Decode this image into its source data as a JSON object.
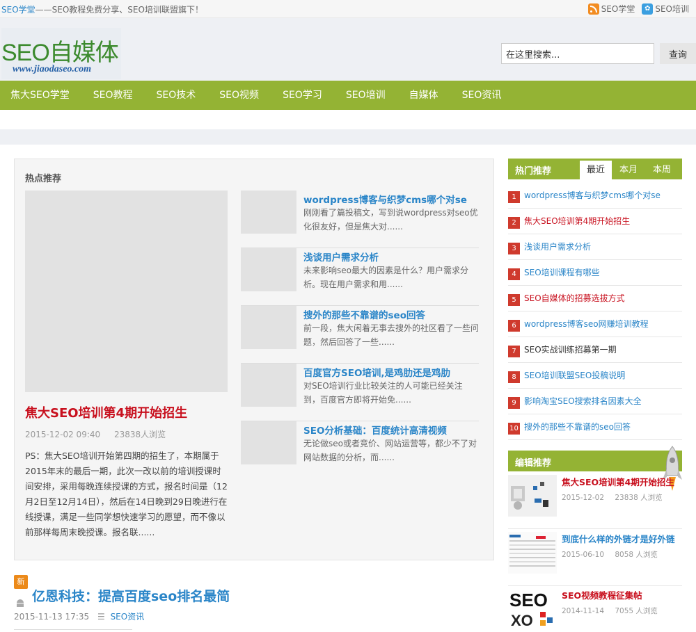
{
  "topbar": {
    "brand": "SEO学堂",
    "tagline": "——SEO教程免费分享、SEO培训联盟旗下！",
    "rss_label": "SEO学堂",
    "weibo_label": "SEO培训"
  },
  "header": {
    "logo_text": "SEO自媒体",
    "logo_url_text": "www.jiaodaseo.com",
    "search_value": "在这里搜索...",
    "search_button": "查询"
  },
  "nav": {
    "items": [
      "焦大SEO学堂",
      "SEO教程",
      "SEO技术",
      "SEO视频",
      "SEO学习",
      "SEO培训",
      "自媒体",
      "SEO资讯"
    ]
  },
  "hot": {
    "title": "热点推荐",
    "featured": {
      "title": "焦大SEO培训第4期开始招生",
      "date": "2015-12-02 09:40",
      "views": "23838人浏览",
      "desc": "PS：焦大SEO培训开始第四期的招生了，本期属于2015年末的最后一期，此次一改以前的培训授课时间安排，采用每晚连续授课的方式，报名时间是（12月2日至12月14日），然后在14日晚到29日晚进行在线授课，满足一些同学想快速学习的愿望，而不像以前那样每周末晚授课。报名联......"
    },
    "list": [
      {
        "title": "wordpress博客与织梦cms哪个对se",
        "desc": "刚刚看了篇投稿文，写到说wordpress对seo优化很友好，但是焦大对......"
      },
      {
        "title": "浅谈用户需求分析",
        "desc": "未来影响seo最大的因素是什么？用户需求分析。现在用户需求和用......"
      },
      {
        "title": "搜外的那些不靠谱的seo回答",
        "desc": "前一段，焦大闲着无事去搜外的社区看了一些问题，然后回答了一些......"
      },
      {
        "title": "百度官方SEO培训,是鸡肋还是鸡肋",
        "desc": "对SEO培训行业比较关注的人可能已经关注到，百度官方即将开始免......"
      },
      {
        "title": "SEO分析基础：百度统计高清视频",
        "desc": "无论做seo或者竞价、网站运营等，都少不了对网站数据的分析，而......"
      }
    ]
  },
  "article": {
    "badge": "新",
    "title": "亿恩科技：提高百度seo排名最简",
    "date": "2015-11-13 17:35",
    "category": "SEO资讯"
  },
  "sidebar": {
    "hot_title": "热门推荐",
    "tabs": [
      "最近",
      "本月",
      "本周"
    ],
    "ranking": [
      {
        "num": "1",
        "title": "wordpress博客与织梦cms哪个对se",
        "color": "blue"
      },
      {
        "num": "2",
        "title": "焦大SEO培训第4期开始招生",
        "color": "red"
      },
      {
        "num": "3",
        "title": "浅谈用户需求分析",
        "color": "blue"
      },
      {
        "num": "4",
        "title": "SEO培训课程有哪些",
        "color": "blue"
      },
      {
        "num": "5",
        "title": "SEO自媒体的招募选拔方式",
        "color": "red"
      },
      {
        "num": "6",
        "title": "wordpress博客seo网赚培训教程",
        "color": "blue"
      },
      {
        "num": "7",
        "title": "SEO实战训练招募第一期",
        "color": "dark"
      },
      {
        "num": "8",
        "title": "SEO培训联盟SEO投稿说明",
        "color": "blue"
      },
      {
        "num": "9",
        "title": "影响淘宝SEO搜索排名因素大全",
        "color": "blue"
      },
      {
        "num": "10",
        "title": "搜外的那些不靠谱的seo回答",
        "color": "blue"
      }
    ],
    "editor_title": "编辑推荐",
    "editor_items": [
      {
        "title": "焦大SEO培训第4期开始招生",
        "date": "2015-12-02",
        "views": "23838 人浏览",
        "color": "red"
      },
      {
        "title": "到底什么样的外链才是好外链",
        "date": "2015-06-10",
        "views": "8058 人浏览",
        "color": "blue"
      },
      {
        "title": "SEO视频教程征集帖",
        "date": "2014-11-14",
        "views": "7055 人浏览",
        "color": "red"
      }
    ]
  },
  "colors": {
    "accent_green": "#94b334",
    "link_blue": "#2a85c8",
    "headline_red": "#c8101e",
    "rank_badge": "#cf3a2d"
  }
}
